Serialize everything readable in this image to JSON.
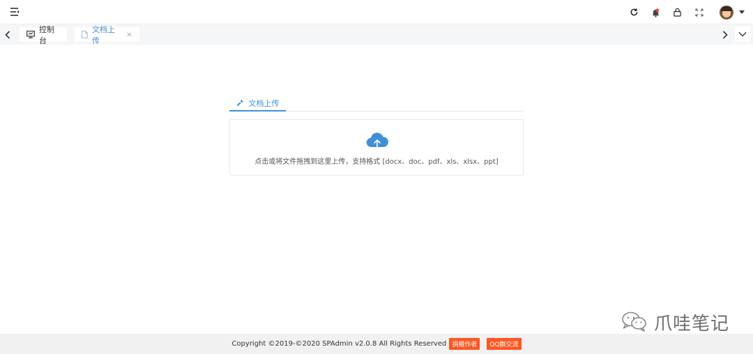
{
  "header": {
    "menu_icon": "menu-fold-icon",
    "icons": [
      "refresh-icon",
      "bell-icon",
      "lock-icon",
      "fullscreen-icon"
    ],
    "notification_color": "#e84c3d"
  },
  "tabs": {
    "home_label": "控制台",
    "active_label": "文档上传",
    "close_glyph": "×"
  },
  "content": {
    "tab_label": "文档上传",
    "upload_hint": "点击或将文件拖拽到这里上传，支持格式 [docx、doc、pdf、xls、xlsx、ppt]",
    "accent_color": "#3f8fd9"
  },
  "watermark": {
    "text": "爪哇笔记"
  },
  "footer": {
    "copyright": "Copyright ©2019-©2020 SPAdmin v2.0.8 All Rights Reserved",
    "donate_label": "捐赠作者",
    "qq_label": "QQ群交流"
  }
}
